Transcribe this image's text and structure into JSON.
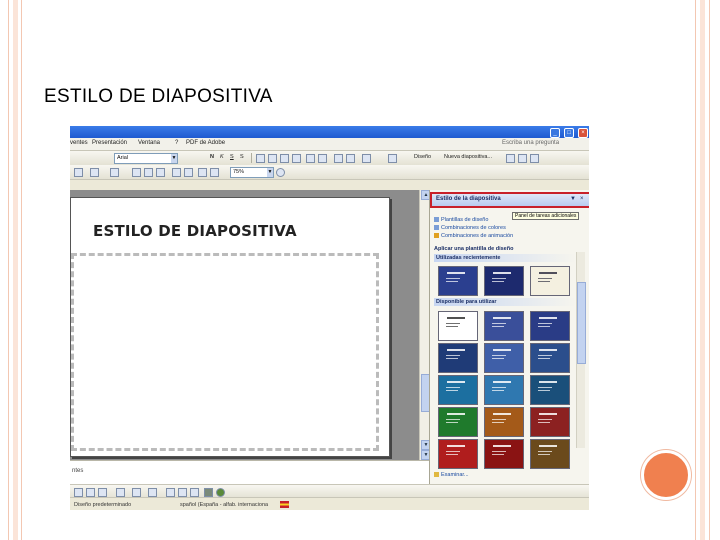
{
  "slide": {
    "title": "ESTILO DE DIAPOSITIVA"
  },
  "app": {
    "menu": [
      "ventes",
      "Presentación",
      "Ventana",
      "?",
      "PDF de Adobe"
    ],
    "question_box": "Escriba una pregunta",
    "font_name": "Arial",
    "zoom": "75%",
    "toolbar_design_label": "Diseño",
    "toolbar_new_slide_label": "Nueva diapositiva...",
    "slide_title": "ESTILO DE DIAPOSITIVA",
    "notes_label": "ntes",
    "status": {
      "design": "Diseño predeterminado",
      "language": "spañol (España - alfab. internaciona"
    }
  },
  "task_pane": {
    "title": "Estilo de la diapositiva",
    "links": [
      "Plantillas de diseño",
      "Combinaciones de colores",
      "Combinaciones de animación"
    ],
    "tooltip": "Panel de tareas adicionales",
    "apply_heading": "Aplicar una plantilla de diseño",
    "recent_heading": "Utilizadas recientemente",
    "available_heading": "Disponible para utilizar",
    "footer_link": "Examinar..."
  },
  "thumb_colors": {
    "recent": [
      "#2b3f8f",
      "#1d2a6e",
      "#f4f0e0"
    ],
    "available": [
      [
        "#ffffff",
        "#3a4f9a",
        "#2a3c86"
      ],
      [
        "#1f3b77",
        "#3f5fa8",
        "#2b4e8c"
      ],
      [
        "#1c6fa0",
        "#2f78b0",
        "#1a4f7a"
      ],
      [
        "#1f7a2c",
        "#a45a19",
        "#8c2121"
      ],
      [
        "#b01d1d",
        "#8a1313",
        "#6b4a1c"
      ]
    ]
  },
  "colors": {
    "slide_border": "#f6c9b4",
    "accent_orb": "#f0804f",
    "highlight_box": "#c8202a"
  }
}
